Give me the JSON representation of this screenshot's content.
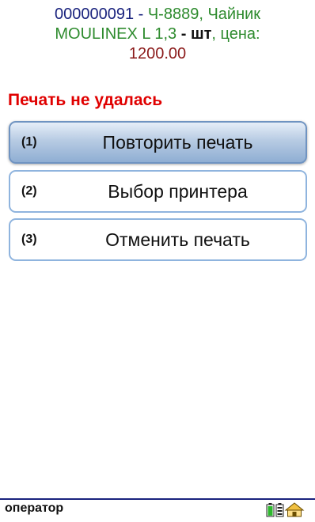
{
  "item": {
    "code": "000000091",
    "sep1": " - ",
    "name_part1": "Ч-8889, Чайник",
    "name_part2": "MOULINEX L 1,3",
    "sep2": " - ",
    "unit": "шт",
    "price_label": ", цена:",
    "price": "1200.00"
  },
  "error_message": "Печать не удалась",
  "buttons": [
    {
      "key": "(1)",
      "label": "Повторить печать"
    },
    {
      "key": "(2)",
      "label": "Выбор принтера"
    },
    {
      "key": "(3)",
      "label": "Отменить печать"
    }
  ],
  "statusbar": {
    "user": "оператор",
    "icons": [
      "battery-icon",
      "sync-icon",
      "home-icon"
    ]
  }
}
